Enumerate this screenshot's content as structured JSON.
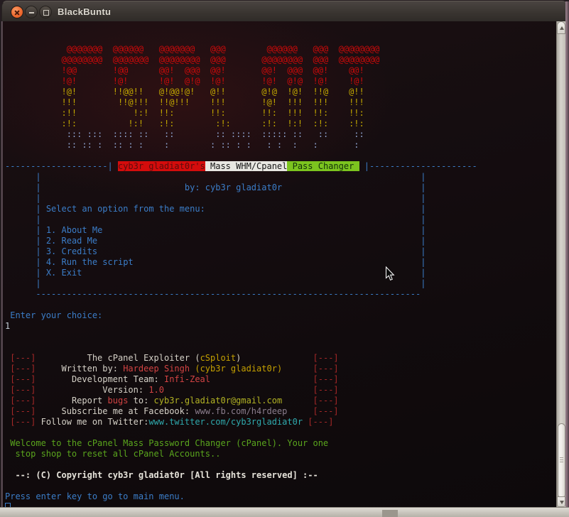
{
  "window": {
    "title": "BlackBuntu"
  },
  "palette": {
    "blue": "#3b7dc8",
    "artRed": "#cc0a0a",
    "artYellow": "#c2a800",
    "artBlue": "#8fa3cf",
    "white": "#d6d2c8",
    "brightWhite": "#e6e3da",
    "nameRed": "#d24343",
    "bracketRed": "#a52828",
    "yellow": "#c4a000",
    "yellowGreen": "#b2b324",
    "cyan": "#2fa9ad",
    "grayPurple": "#8a7d8d",
    "green": "#5aa51d",
    "inputWhite": "#c6cfd8",
    "badgeRedBg": "#d40c0c",
    "badgeRedText": "#5c0d0d",
    "badgeWhiteBg": "#e8e7e2",
    "badgeWhiteText": "#161616",
    "badgeGreenBg": "#7cc41f",
    "badgeGreenText": "#12300a",
    "cursorBlue": "#3b7dc8"
  },
  "terminal": {
    "lines": [
      {
        "s": []
      },
      {
        "s": []
      },
      {
        "s": [
          {
            "col": 11
          },
          {
            "t": " @@@@@@@  @@@@@@   @@@@@@@   @@@        @@@@@@   @@@  @@@@@@@@",
            "c": "artRed",
            "n": "ascii-art-line"
          }
        ]
      },
      {
        "s": [
          {
            "col": 11
          },
          {
            "t": "@@@@@@@@  @@@@@@@  @@@@@@@@  @@@       @@@@@@@@  @@@  @@@@@@@@",
            "c": "artRed",
            "n": "ascii-art-line"
          }
        ]
      },
      {
        "s": [
          {
            "col": 11
          },
          {
            "t": "!@@       !@@      @@!  @@@  @@!       @@!  @@@  @@!    @@!   ",
            "c": "artRed",
            "n": "ascii-art-line"
          }
        ]
      },
      {
        "s": [
          {
            "col": 11
          },
          {
            "t": "!@!       !@!      !@!  @!@  !@!       !@!  @!@  !@!    !@!   ",
            "c": "artRed",
            "n": "ascii-art-line"
          }
        ]
      },
      {
        "s": [
          {
            "col": 11
          },
          {
            "t": "!@!       !!@@!!   @!@@!@!   @!!       @!@  !@!  !!@    @!!   ",
            "c": "artYellow",
            "n": "ascii-art-line"
          }
        ]
      },
      {
        "s": [
          {
            "col": 11
          },
          {
            "t": "!!!        !!@!!!  !!@!!!    !!!       !@!  !!!  !!!    !!!   ",
            "c": "artYellow",
            "n": "ascii-art-line"
          }
        ]
      },
      {
        "s": [
          {
            "col": 11
          },
          {
            "t": ":!!           !:!  !!:       !!:       !!:  !!!  !!:    !!:   ",
            "c": "artYellow",
            "n": "ascii-art-line"
          }
        ]
      },
      {
        "s": [
          {
            "col": 11
          },
          {
            "t": ":!:          !:!   :!:        :!:      :!:  !:!  :!:    :!:   ",
            "c": "artYellow",
            "n": "ascii-art-line"
          }
        ]
      },
      {
        "s": [
          {
            "col": 11
          },
          {
            "t": " ::: :::  :::: ::   ::        :: ::::  ::::: ::   ::     ::   ",
            "c": "artBlue",
            "n": "ascii-art-line"
          }
        ]
      },
      {
        "s": [
          {
            "col": 11
          },
          {
            "t": " :: :: :  :: : :    :        : :: : :   : :  :   :       :    ",
            "c": "artBlue",
            "n": "ascii-art-line"
          }
        ]
      },
      {
        "s": []
      },
      {
        "s": [
          {
            "t": "--------------------|",
            "c": "blue"
          },
          {
            "col": 22
          },
          {
            "t": "cyb3r gladiat0r's",
            "c": "badgeRedText",
            "bg": "badgeRedBg",
            "n": "banner-author-badge"
          },
          {
            "t": " Mass WHM/Cpanel",
            "c": "badgeWhiteText",
            "bg": "badgeWhiteBg",
            "n": "banner-product-badge"
          },
          {
            "t": " Pass Changer ",
            "c": "badgeGreenText",
            "bg": "badgeGreenBg",
            "n": "banner-function-badge"
          },
          {
            "col": 70
          },
          {
            "t": "|---------------------",
            "c": "blue"
          }
        ]
      },
      {
        "s": [
          {
            "col": 6
          },
          {
            "t": "|",
            "c": "blue"
          },
          {
            "col": 81
          },
          {
            "t": "|",
            "c": "blue"
          }
        ]
      },
      {
        "s": [
          {
            "col": 6
          },
          {
            "t": "|",
            "c": "blue"
          },
          {
            "col": 35
          },
          {
            "t": "by: cyb3r gladiat0r",
            "c": "blue",
            "n": "byline"
          },
          {
            "col": 81
          },
          {
            "t": "|",
            "c": "blue"
          }
        ]
      },
      {
        "s": [
          {
            "col": 6
          },
          {
            "t": "|",
            "c": "blue"
          },
          {
            "col": 81
          },
          {
            "t": "|",
            "c": "blue"
          }
        ]
      },
      {
        "s": [
          {
            "col": 6
          },
          {
            "t": "|",
            "c": "blue"
          },
          {
            "col": 8
          },
          {
            "t": "Select an option from the menu:",
            "c": "blue",
            "n": "menu-prompt"
          },
          {
            "col": 81
          },
          {
            "t": "|",
            "c": "blue"
          }
        ]
      },
      {
        "s": [
          {
            "col": 6
          },
          {
            "t": "|",
            "c": "blue"
          },
          {
            "col": 81
          },
          {
            "t": "|",
            "c": "blue"
          }
        ]
      },
      {
        "s": [
          {
            "col": 6
          },
          {
            "t": "|",
            "c": "blue"
          },
          {
            "col": 8
          },
          {
            "t": "1. About Me",
            "c": "blue",
            "n": "menu-item-about"
          },
          {
            "col": 81
          },
          {
            "t": "|",
            "c": "blue"
          }
        ]
      },
      {
        "s": [
          {
            "col": 6
          },
          {
            "t": "|",
            "c": "blue"
          },
          {
            "col": 8
          },
          {
            "t": "2. Read Me",
            "c": "blue",
            "n": "menu-item-readme"
          },
          {
            "col": 81
          },
          {
            "t": "|",
            "c": "blue"
          }
        ]
      },
      {
        "s": [
          {
            "col": 6
          },
          {
            "t": "|",
            "c": "blue"
          },
          {
            "col": 8
          },
          {
            "t": "3. Credits",
            "c": "blue",
            "n": "menu-item-credits"
          },
          {
            "col": 81
          },
          {
            "t": "|",
            "c": "blue"
          }
        ]
      },
      {
        "s": [
          {
            "col": 6
          },
          {
            "t": "|",
            "c": "blue"
          },
          {
            "col": 8
          },
          {
            "t": "4. Run the script",
            "c": "blue",
            "n": "menu-item-run"
          },
          {
            "col": 81
          },
          {
            "t": "|",
            "c": "blue"
          }
        ]
      },
      {
        "s": [
          {
            "col": 6
          },
          {
            "t": "|",
            "c": "blue"
          },
          {
            "col": 8
          },
          {
            "t": "X. Exit",
            "c": "blue",
            "n": "menu-item-exit"
          },
          {
            "col": 81
          },
          {
            "t": "|",
            "c": "blue"
          }
        ]
      },
      {
        "s": [
          {
            "col": 6
          },
          {
            "t": "|",
            "c": "blue"
          },
          {
            "col": 81
          },
          {
            "t": "|",
            "c": "blue"
          }
        ]
      },
      {
        "s": [
          {
            "col": 6
          },
          {
            "t": "---------------------------------------------------------------------------",
            "c": "blue"
          }
        ]
      },
      {
        "s": []
      },
      {
        "s": [
          {
            "col": 1
          },
          {
            "t": "Enter your choice:",
            "c": "blue",
            "n": "prompt-enter-choice"
          }
        ]
      },
      {
        "s": [
          {
            "t": "1",
            "c": "inputWhite",
            "n": "user-input"
          }
        ]
      },
      {
        "s": []
      },
      {
        "s": []
      },
      {
        "s": [
          {
            "col": 1
          },
          {
            "t": "[---]",
            "c": "bracketRed"
          },
          {
            "col": 16
          },
          {
            "t": "The cPanel Exploiter (",
            "c": "white"
          },
          {
            "t": "cSploit",
            "c": "yellow"
          },
          {
            "t": ")",
            "c": "white"
          },
          {
            "col": 60
          },
          {
            "t": "[---]",
            "c": "bracketRed"
          }
        ]
      },
      {
        "s": [
          {
            "col": 1
          },
          {
            "t": "[---]",
            "c": "bracketRed"
          },
          {
            "col": 11
          },
          {
            "t": "Written by: ",
            "c": "white"
          },
          {
            "t": "Hardeep Singh",
            "c": "nameRed",
            "n": "author-name"
          },
          {
            "t": " ",
            "c": "white"
          },
          {
            "t": "(cyb3r gladiat0r)",
            "c": "yellow"
          },
          {
            "col": 60
          },
          {
            "t": "[---]",
            "c": "bracketRed"
          }
        ]
      },
      {
        "s": [
          {
            "col": 1
          },
          {
            "t": "[---]",
            "c": "bracketRed"
          },
          {
            "col": 13
          },
          {
            "t": "Development Team: ",
            "c": "white"
          },
          {
            "t": "Infi-Zeal",
            "c": "nameRed",
            "n": "team-name"
          },
          {
            "col": 60
          },
          {
            "t": "[---]",
            "c": "bracketRed"
          }
        ]
      },
      {
        "s": [
          {
            "col": 1
          },
          {
            "t": "[---]",
            "c": "bracketRed"
          },
          {
            "col": 19
          },
          {
            "t": "Version: ",
            "c": "white"
          },
          {
            "t": "1.0",
            "c": "nameRed",
            "n": "version-number"
          },
          {
            "col": 60
          },
          {
            "t": "[---]",
            "c": "bracketRed"
          }
        ]
      },
      {
        "s": [
          {
            "col": 1
          },
          {
            "t": "[---]",
            "c": "bracketRed"
          },
          {
            "col": 13
          },
          {
            "t": "Report ",
            "c": "white"
          },
          {
            "t": "bugs",
            "c": "nameRed"
          },
          {
            "t": " to: ",
            "c": "white"
          },
          {
            "t": "cyb3r.gladiat0r@gmail.com",
            "c": "yellowGreen",
            "n": "email-link",
            "i": true
          },
          {
            "col": 60
          },
          {
            "t": "[---]",
            "c": "bracketRed"
          }
        ]
      },
      {
        "s": [
          {
            "col": 1
          },
          {
            "t": "[---]",
            "c": "bracketRed"
          },
          {
            "col": 11
          },
          {
            "t": "Subscribe me at Facebook: ",
            "c": "white"
          },
          {
            "t": "www.fb.com/h4rdeep",
            "c": "grayPurple",
            "n": "facebook-link",
            "i": true
          },
          {
            "col": 60
          },
          {
            "t": "[---]",
            "c": "bracketRed"
          }
        ]
      },
      {
        "s": [
          {
            "col": 1
          },
          {
            "t": "[---]",
            "c": "bracketRed"
          },
          {
            "t": " ",
            "c": "white"
          },
          {
            "t": "Follow me on Twitter:",
            "c": "white"
          },
          {
            "t": "www.twitter.com/cyb3rgladiat0r",
            "c": "cyan",
            "n": "twitter-link",
            "i": true
          },
          {
            "t": " ",
            "c": "white"
          },
          {
            "t": "[---]",
            "c": "bracketRed"
          }
        ]
      },
      {
        "s": []
      },
      {
        "s": [
          {
            "col": 1
          },
          {
            "t": "Welcome to the cPanel Mass Password Changer (cPanel). Your one",
            "c": "green",
            "n": "welcome-text"
          }
        ]
      },
      {
        "s": [
          {
            "col": 2
          },
          {
            "t": "stop shop to reset all cPanel Accounts..",
            "c": "green",
            "n": "welcome-text"
          }
        ]
      },
      {
        "s": []
      },
      {
        "s": [
          {
            "col": 2
          },
          {
            "t": "--: (C) Copyright cyb3r gladiat0r [All rights reserved] :--",
            "c": "brightWhite",
            "bold": true,
            "n": "copyright-text"
          }
        ]
      },
      {
        "s": []
      },
      {
        "s": [
          {
            "t": "Press enter key to go to main menu.",
            "c": "blue",
            "n": "prompt-press-enter"
          }
        ]
      },
      {
        "s": [
          {
            "cursor": true,
            "n": "terminal-cursor"
          }
        ]
      }
    ]
  }
}
